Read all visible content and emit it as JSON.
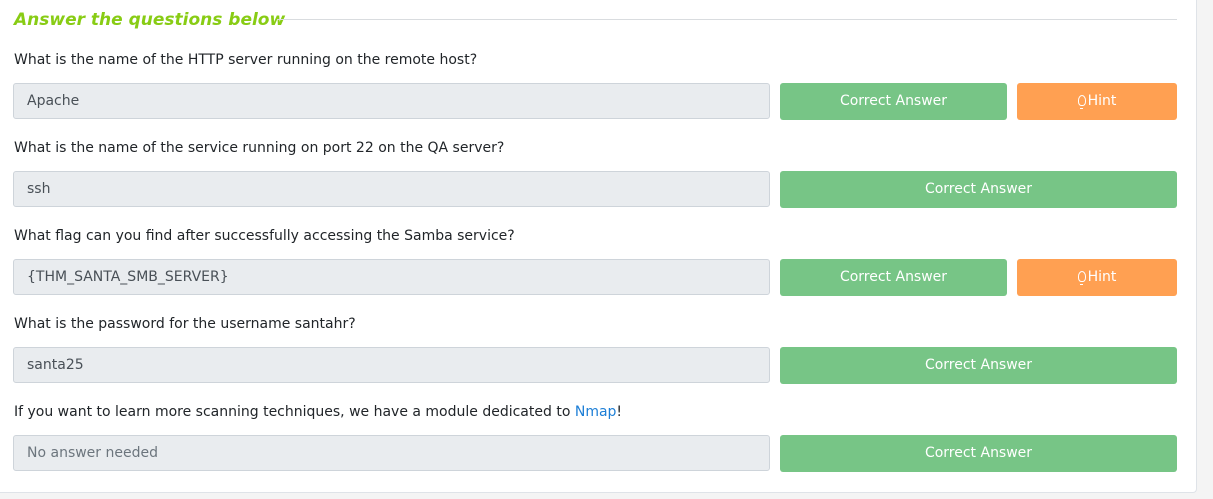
{
  "section": {
    "title": "Answer the questions below"
  },
  "colors": {
    "title_green": "#88cc14",
    "correct": "#77c586",
    "hint": "#ffa052",
    "link": "#1c7ed6"
  },
  "questions": [
    {
      "text": "What is the name of the HTTP server running on the remote host?",
      "answer": "Apache",
      "button": "Correct Answer",
      "hint": "Hint"
    },
    {
      "text": "What is the name of the service running on port 22 on the QA server?",
      "answer": "ssh",
      "button": "Correct Answer"
    },
    {
      "text": "What flag can you find after successfully accessing the Samba service?",
      "answer": "{THM_SANTA_SMB_SERVER}",
      "button": "Correct Answer",
      "hint": "Hint"
    },
    {
      "text": "What is the password for the username santahr?",
      "answer": "santa25",
      "button": "Correct Answer"
    },
    {
      "text_before": "If you want to learn more scanning techniques, we have a module dedicated to ",
      "link": "Nmap",
      "text_after": "!",
      "answer_placeholder": "No answer needed",
      "button": "Correct Answer"
    }
  ],
  "icons": {
    "hint_icon": "lightbulb-icon"
  }
}
